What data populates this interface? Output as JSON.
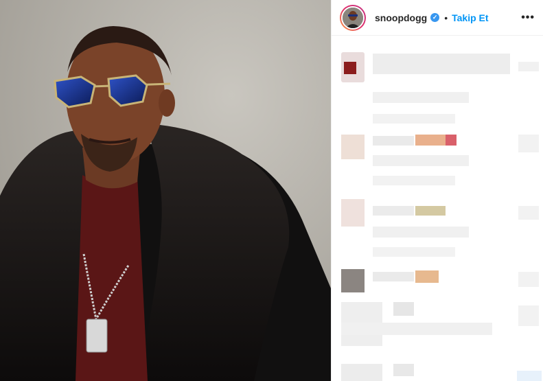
{
  "post": {
    "author": {
      "username": "snoopdogg",
      "verified_icon": "check",
      "follow_label": "Takip Et",
      "separator": "•"
    },
    "more_icon": "•••"
  },
  "colors": {
    "follow": "#0095f6",
    "verified": "#3897f0",
    "text": "#262626"
  }
}
